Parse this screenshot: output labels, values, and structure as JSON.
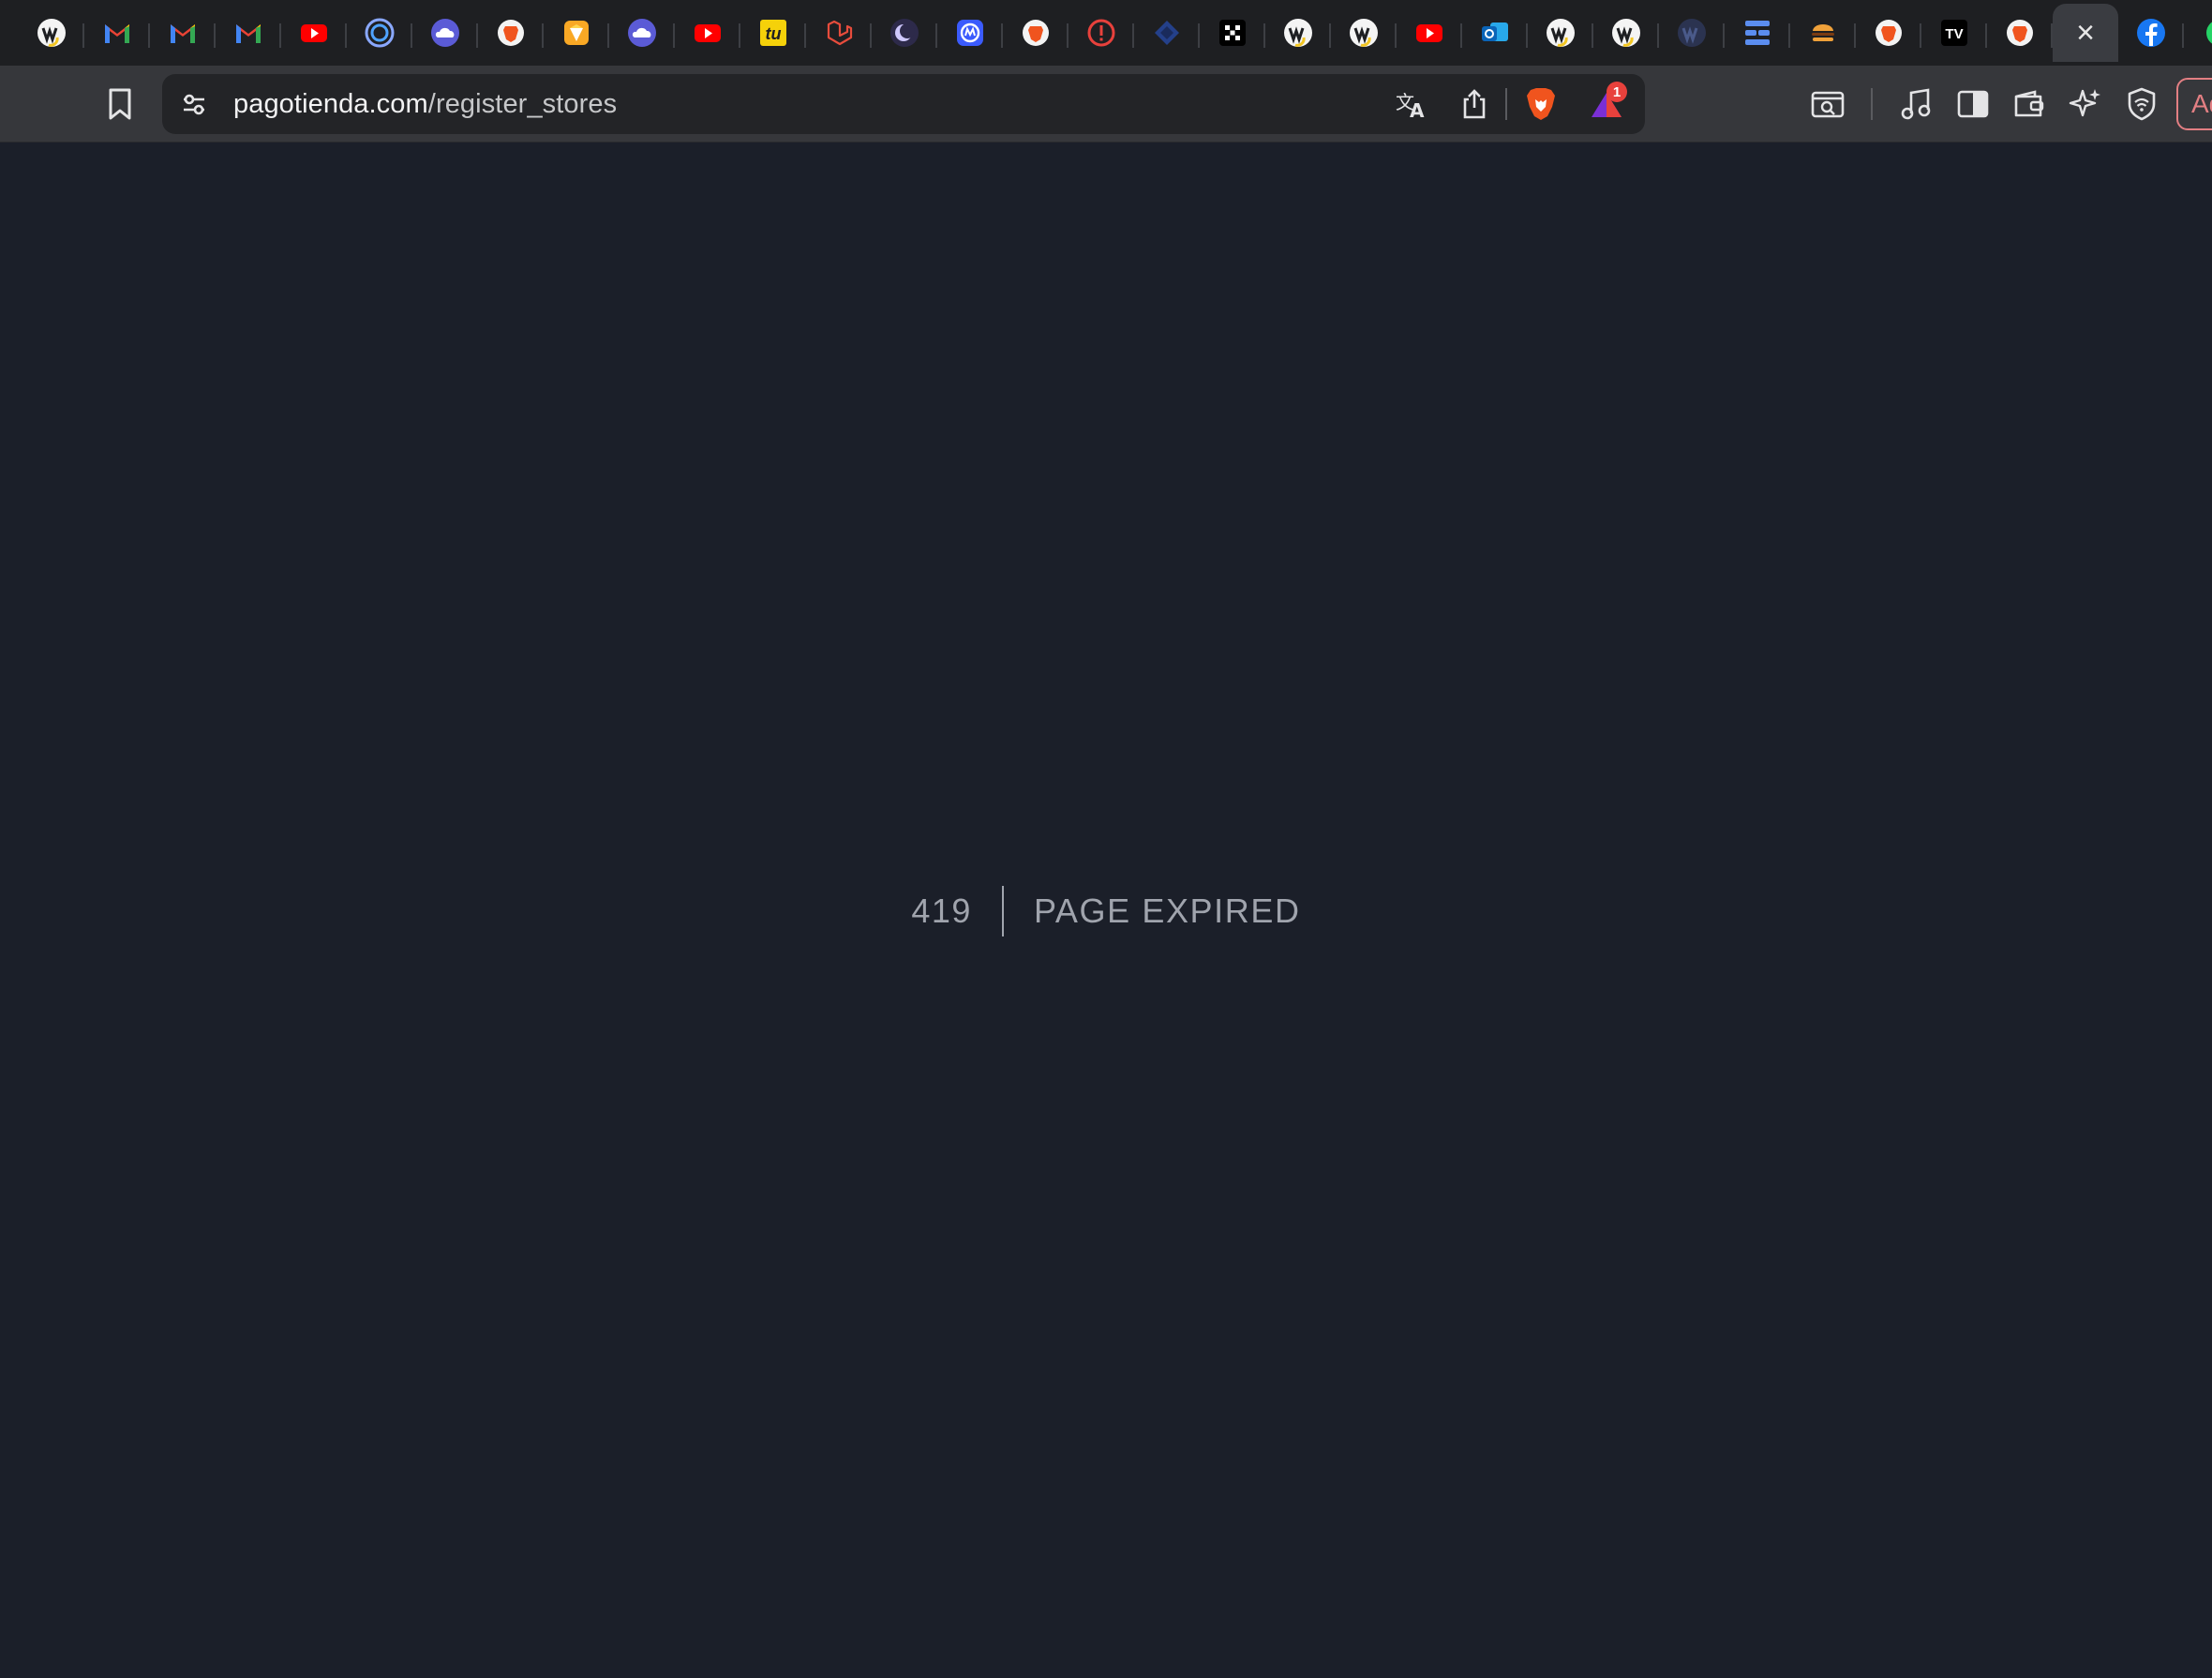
{
  "tabs": [
    {
      "name": "tab-w-logo-1",
      "icon": "w-logo-icon"
    },
    {
      "name": "tab-gmail-1",
      "icon": "gmail-icon"
    },
    {
      "name": "tab-gmail-2",
      "icon": "gmail-icon"
    },
    {
      "name": "tab-gmail-3",
      "icon": "gmail-icon"
    },
    {
      "name": "tab-youtube-1",
      "icon": "youtube-icon"
    },
    {
      "name": "tab-ring-1",
      "icon": "ring-icon"
    },
    {
      "name": "tab-cloud-1",
      "icon": "cloud-icon"
    },
    {
      "name": "tab-brave-1",
      "icon": "brave-icon"
    },
    {
      "name": "tab-sketch-1",
      "icon": "sketch-icon"
    },
    {
      "name": "tab-cloud-2",
      "icon": "cloud-icon"
    },
    {
      "name": "tab-youtube-2",
      "icon": "youtube-icon"
    },
    {
      "name": "tab-tu-1",
      "icon": "tu-icon",
      "label": "tu"
    },
    {
      "name": "tab-laravel-1",
      "icon": "laravel-icon"
    },
    {
      "name": "tab-moon-1",
      "icon": "moon-icon"
    },
    {
      "name": "tab-at-1",
      "icon": "at-icon"
    },
    {
      "name": "tab-brave-2",
      "icon": "brave-icon"
    },
    {
      "name": "tab-alert-1",
      "icon": "alert-icon"
    },
    {
      "name": "tab-diamond-1",
      "icon": "diamond-icon"
    },
    {
      "name": "tab-checker-1",
      "icon": "checker-icon"
    },
    {
      "name": "tab-w-logo-2",
      "icon": "w-logo-icon"
    },
    {
      "name": "tab-w-logo-3",
      "icon": "w-logo-icon"
    },
    {
      "name": "tab-youtube-3",
      "icon": "youtube-icon"
    },
    {
      "name": "tab-outlook-1",
      "icon": "outlook-icon"
    },
    {
      "name": "tab-w-logo-4",
      "icon": "w-logo-icon"
    },
    {
      "name": "tab-w-logo-5",
      "icon": "w-logo-icon"
    },
    {
      "name": "tab-w-logo-dark-1",
      "icon": "w-logo-dark-icon"
    },
    {
      "name": "tab-bars-1",
      "icon": "bars-icon"
    },
    {
      "name": "tab-burger-1",
      "icon": "burger-icon"
    },
    {
      "name": "tab-brave-3",
      "icon": "brave-icon"
    },
    {
      "name": "tab-tradingview-1",
      "icon": "tradingview-icon",
      "label": "TV"
    },
    {
      "name": "tab-brave-4",
      "icon": "brave-icon"
    },
    {
      "name": "tab-active-close",
      "icon": "close-icon",
      "active": true
    },
    {
      "name": "tab-facebook-1",
      "icon": "facebook-icon"
    },
    {
      "name": "tab-whatsapp-1",
      "icon": "whatsapp-icon"
    }
  ],
  "toolbar": {
    "url_host": "pagotienda.com",
    "url_path": "/register_stores",
    "notification_count": "1",
    "adblock_label": "Ad"
  },
  "page": {
    "status_code": "419",
    "message": "PAGE EXPIRED"
  },
  "colors": {
    "page_bg": "#1b1f29",
    "error_text": "#a0a4ad",
    "toolbar_bg": "#36373b",
    "tabstrip_bg": "#1e1f22"
  }
}
